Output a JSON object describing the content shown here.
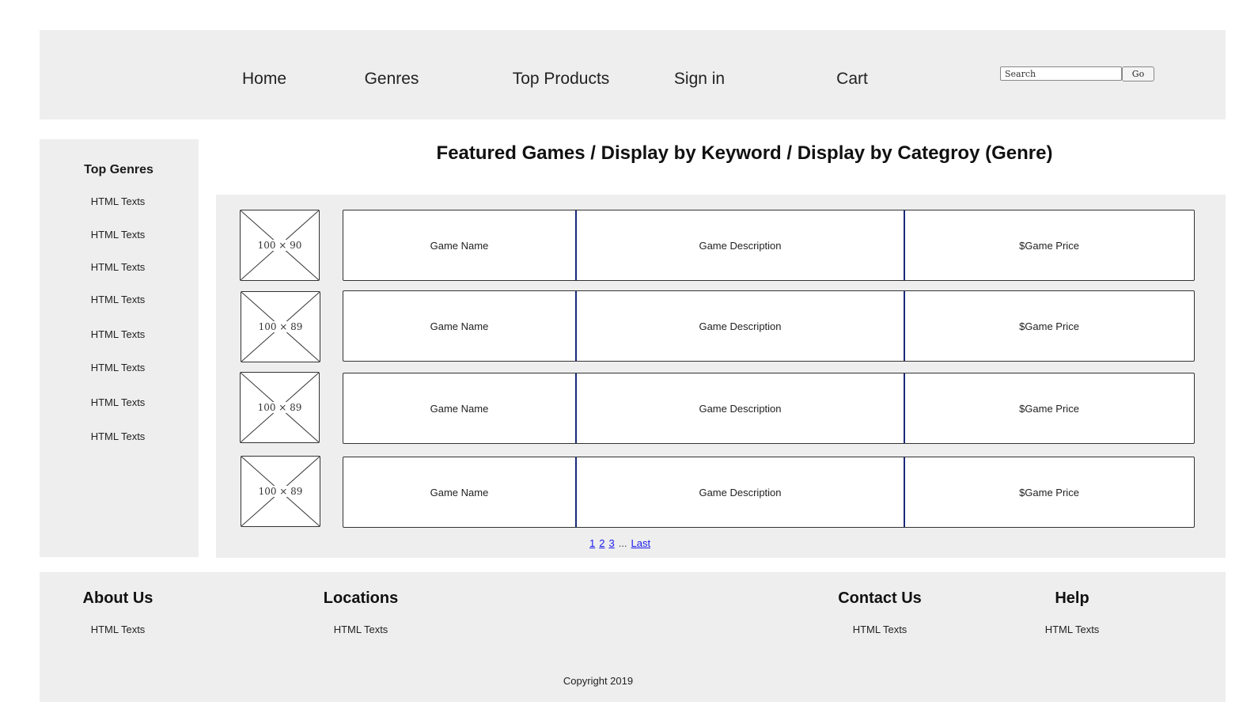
{
  "nav": {
    "home": "Home",
    "genres": "Genres",
    "top_products": "Top Products",
    "sign_in": "Sign in",
    "cart": "Cart"
  },
  "search": {
    "placeholder": "Search",
    "go_label": "Go"
  },
  "sidebar": {
    "title": "Top Genres",
    "items": [
      "HTML Texts",
      "HTML Texts",
      "HTML Texts",
      "HTML Texts",
      "HTML Texts",
      "HTML Texts",
      "HTML Texts",
      "HTML Texts"
    ]
  },
  "main": {
    "title": "Featured Games / Display by Keyword / Display by Categroy (Genre)",
    "games": [
      {
        "thumb": "100 × 90",
        "name": "Game Name",
        "description": "Game Description",
        "price": "$Game Price"
      },
      {
        "thumb": "100 × 89",
        "name": "Game Name",
        "description": "Game Description",
        "price": "$Game Price"
      },
      {
        "thumb": "100 × 89",
        "name": "Game Name",
        "description": "Game Description",
        "price": "$Game Price"
      },
      {
        "thumb": "100 × 89",
        "name": "Game Name",
        "description": "Game Description",
        "price": "$Game Price"
      }
    ],
    "pagination": {
      "p1": "1",
      "p2": "2",
      "p3": "3",
      "ellipsis": "...",
      "last": "Last"
    }
  },
  "footer": {
    "about": {
      "heading": "About Us",
      "text": "HTML Texts"
    },
    "locations": {
      "heading": "Locations",
      "text": "HTML Texts"
    },
    "contact": {
      "heading": "Contact Us",
      "text": "HTML Texts"
    },
    "help": {
      "heading": "Help",
      "text": "HTML Texts"
    },
    "copyright": "Copyright 2019"
  },
  "colors": {
    "panel_bg": "#eeeeee",
    "link": "#1a1aee",
    "cell_divider": "#1a2a7a"
  }
}
